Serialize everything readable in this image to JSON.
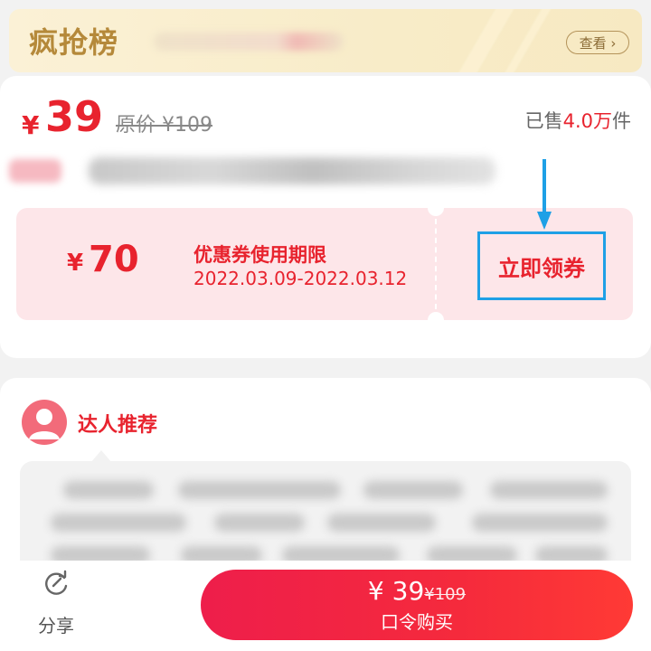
{
  "banner": {
    "title": "疯抢榜",
    "view_label": "查看 ›",
    "bg_color": "#fbf1d6"
  },
  "product": {
    "currency": "¥",
    "price": "39",
    "original_price_text": "原价 ¥109",
    "sold_prefix": "已售",
    "sold_count": "4.0万",
    "sold_suffix": "件"
  },
  "coupon": {
    "currency": "¥",
    "amount": "70",
    "label": "优惠券使用期限",
    "date_range": "2022.03.09-2022.03.12",
    "claim_label": "立即领券",
    "bg_color": "#fde6e9",
    "highlight_color": "#1ea0e6"
  },
  "recommend": {
    "title": "达人推荐"
  },
  "bottom_bar": {
    "share_label": "分享",
    "buy_price": "¥ 39",
    "buy_original": "¥109",
    "buy_label": "口令购买",
    "accent": "#f5283f"
  },
  "icons": [
    "share-icon",
    "user-avatar-icon",
    "arrow-down-icon"
  ]
}
